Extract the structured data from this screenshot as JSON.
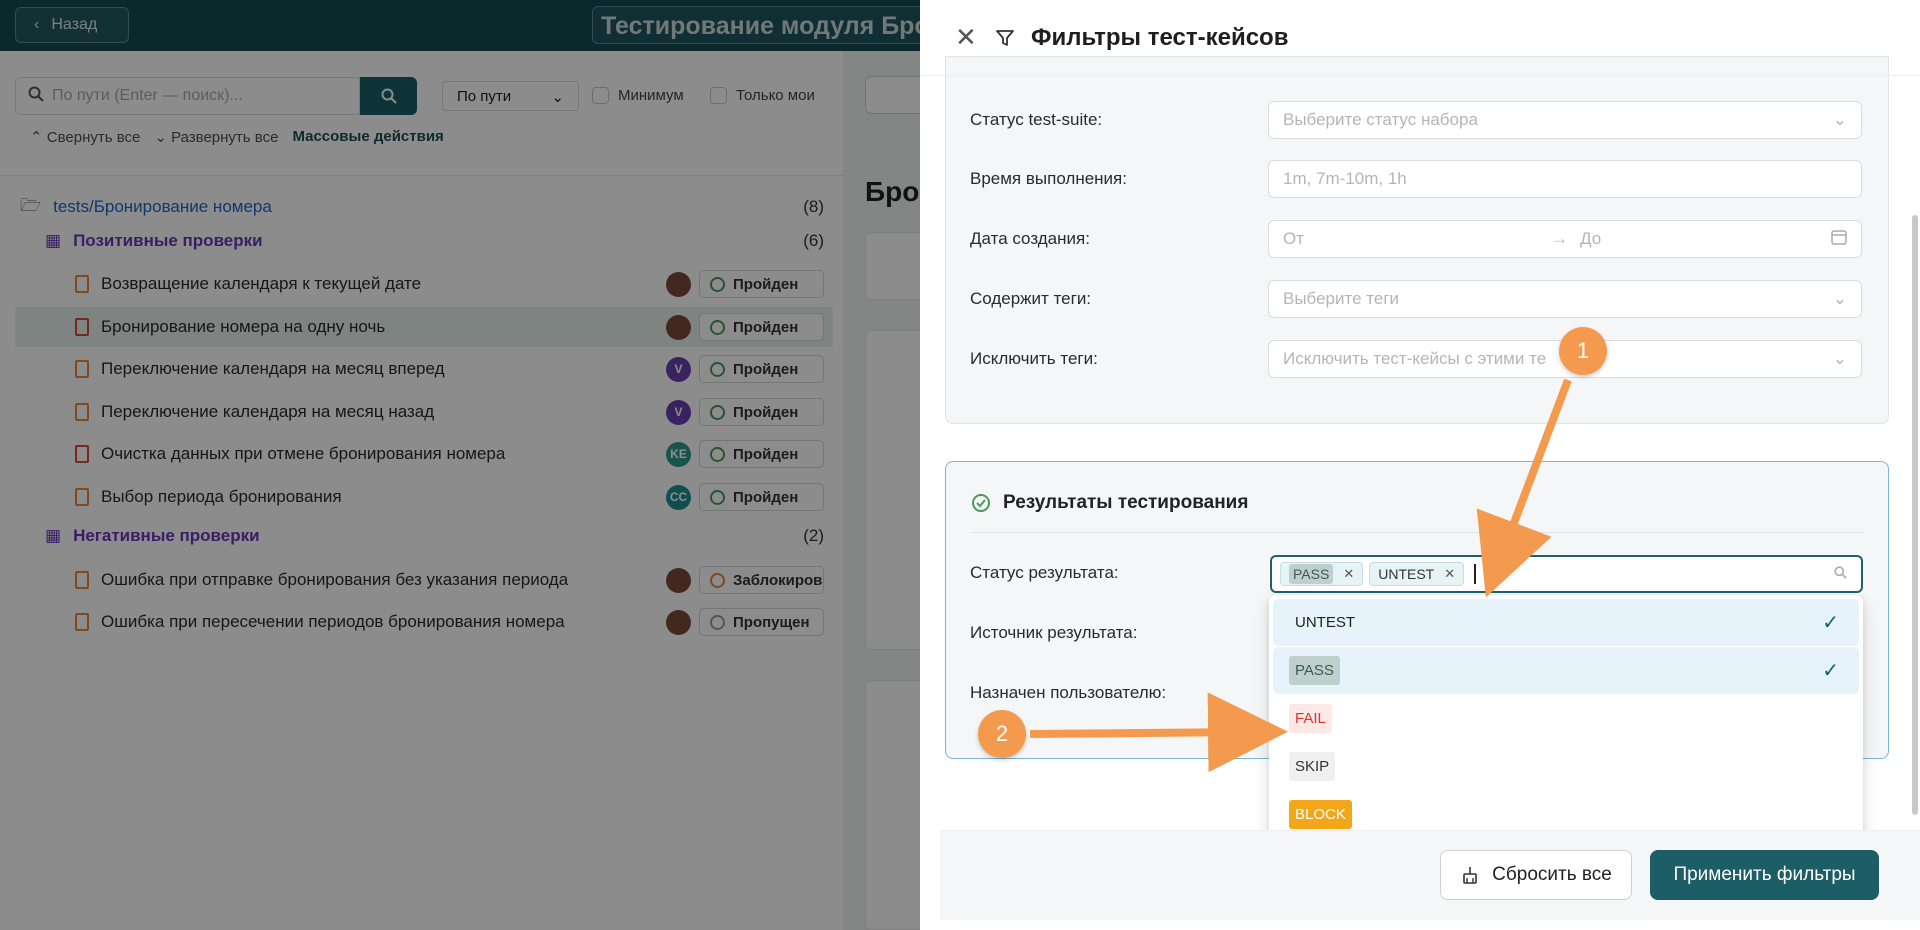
{
  "topbar": {
    "back_label": "Назад",
    "title": "Тестирование модуля Брон"
  },
  "left": {
    "search_placeholder": "По пути (Enter — поиск)...",
    "path_select": "По пути",
    "chk_min": "Минимум",
    "chk_mine": "Только мои",
    "collapse_all": "Свернуть все",
    "expand_all": "Развернуть все",
    "bulk_actions": "Массовые действия",
    "root": {
      "label": "tests/Бронирование номера",
      "count": "(8)"
    },
    "groups": [
      {
        "label": "Позитивные проверки",
        "count": "(6)"
      },
      {
        "label": "Негативные проверки",
        "count": "(2)"
      }
    ],
    "items": [
      {
        "label": "Возвращение календаря к текущей дате",
        "status": "Пройден",
        "avatar": "",
        "avatar_color": "#7a4a3a"
      },
      {
        "label": "Бронирование номера на одну ночь",
        "status": "Пройден",
        "avatar": "",
        "avatar_color": "#7a4a3a"
      },
      {
        "label": "Переключение календаря на месяц вперед",
        "status": "Пройден",
        "avatar": "V",
        "avatar_color": "#6b3fb0"
      },
      {
        "label": "Переключение календаря на месяц назад",
        "status": "Пройден",
        "avatar": "V",
        "avatar_color": "#6b3fb0"
      },
      {
        "label": "Очистка данных при отмене бронирования номера",
        "status": "Пройден",
        "avatar": "KE",
        "avatar_color": "#2a9c8a"
      },
      {
        "label": "Выбор периода бронирования",
        "status": "Пройден",
        "avatar": "CC",
        "avatar_color": "#1e8f96"
      },
      {
        "label": "Ошибка при отправке бронирования без указания периода",
        "status": "Заблокиров",
        "avatar": "",
        "avatar_color": "#7a4a3a"
      },
      {
        "label": "Ошибка при пересечении периодов бронирования номера",
        "status": "Пропущен",
        "avatar": "",
        "avatar_color": "#7a4a3a"
      }
    ]
  },
  "right_bg": {
    "title": "Брон"
  },
  "drawer": {
    "title": "Фильтры тест-кейсов",
    "rows": [
      {
        "label": "Статус test-suite:",
        "placeholder": "Выберите статус набора"
      },
      {
        "label": "Время выполнения:",
        "placeholder": "1m, 7m-10m, 1h"
      },
      {
        "label": "Дата создания:",
        "from": "От",
        "to": "До"
      },
      {
        "label": "Содержит теги:",
        "placeholder": "Выберите теги"
      },
      {
        "label": "Исключить теги:",
        "placeholder": "Исключить тест-кейсы с этими те"
      }
    ],
    "results_title": "Результаты тестирования",
    "result_status_label": "Статус результата:",
    "result_source_label": "Источник результата:",
    "assigned_label": "Назначен пользователю:",
    "chips": [
      "PASS",
      "UNTEST"
    ],
    "options": [
      {
        "label": "UNTEST",
        "selected": true,
        "bg": "transparent",
        "color": "#333333"
      },
      {
        "label": "PASS",
        "selected": true,
        "bg": "#bfcfcc",
        "color": "#3d5a5a"
      },
      {
        "label": "FAIL",
        "selected": false,
        "bg": "#fde8e6",
        "color": "#d9362b"
      },
      {
        "label": "SKIP",
        "selected": false,
        "bg": "#f0f0f0",
        "color": "#333333"
      },
      {
        "label": "BLOCK",
        "selected": false,
        "bg": "#f2a71b",
        "color": "#ffffff"
      }
    ],
    "reset_label": "Сбросить все",
    "apply_label": "Применить фильтры"
  },
  "annotations": [
    "1",
    "2"
  ],
  "colors": {
    "accent": "#1d5d66",
    "annotation": "#f39a4f"
  }
}
